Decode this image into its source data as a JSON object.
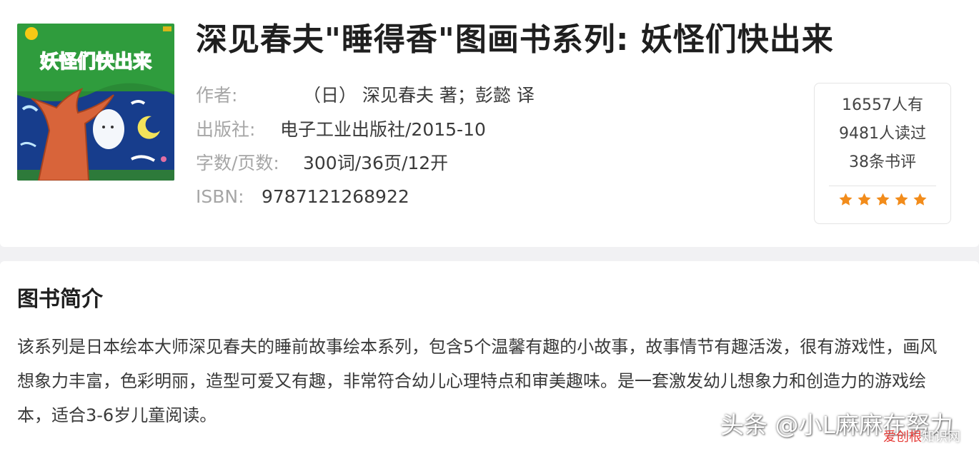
{
  "book": {
    "title": "深见春夫\"睡得香\"图画书系列: 妖怪们快出来",
    "cover_title": "妖怪们快出来",
    "meta": {
      "author_label": "作者:",
      "author_value": "（日） 深见春夫 著；彭懿 译",
      "publisher_label": "出版社:",
      "publisher_value": "电子工业出版社/2015-10",
      "words_label": "字数/页数:",
      "words_value": "300词/36页/12开",
      "isbn_label": "ISBN:",
      "isbn_value": "9787121268922"
    }
  },
  "stats": {
    "have": "16557人有",
    "read": "9481人读过",
    "reviews": "38条书评",
    "rating": 5,
    "star_color": "#f28c1b"
  },
  "intro": {
    "heading": "图书简介",
    "text": "该系列是日本绘本大师深见春夫的睡前故事绘本系列，包含5个温馨有趣的小故事，故事情节有趣活泼，很有游戏性，画风想象力丰富，色彩明丽，造型可爱又有趣，非常符合幼儿心理特点和审美趣味。是一套激发幼儿想象力和创造力的游戏绘本，适合3-6岁儿童阅读。"
  },
  "watermark": {
    "main": "头条 @小L麻麻在努力",
    "site_accent": "爱创根",
    "site_rest": "知识网"
  }
}
